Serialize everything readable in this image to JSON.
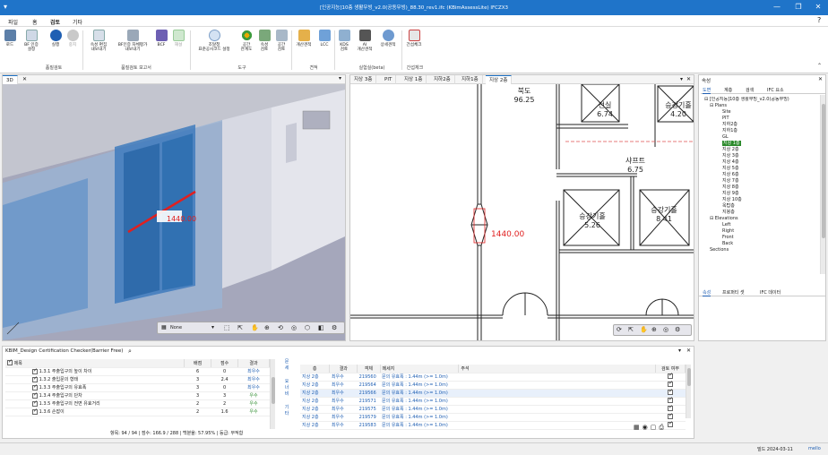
{
  "title": "[인공지능]10층 생활무빙_v2.0(공동무빙)_88.30_rev1.ifc (KBimAssessLite) IFCZX3",
  "menu": [
    "파일",
    "홈",
    "검토",
    "기타"
  ],
  "ribbon": {
    "buttons": [
      {
        "label": "로드",
        "icon": "load-icon"
      },
      {
        "label": "BF 인증\n설정",
        "icon": "document-settings-icon"
      },
      {
        "label": "실행",
        "icon": "play-icon"
      },
      {
        "label": "중지",
        "icon": "stop-icon"
      },
      {
        "label": "속성 편집\n내보내기",
        "icon": "properties-edit-icon"
      },
      {
        "label": "BF인증 자체평가\n내보내기",
        "icon": "export-icon"
      },
      {
        "label": "BCF",
        "icon": "bcf-icon"
      },
      {
        "label": "해설",
        "icon": "commentary-icon"
      },
      {
        "label": "조달청\n표준공사코드 설정",
        "icon": "standard-code-icon"
      },
      {
        "label": "공간\n관계도",
        "icon": "space-relation-icon"
      },
      {
        "label": "속성\n검토",
        "icon": "property-review-icon"
      },
      {
        "label": "공간\n검토",
        "icon": "space-review-icon"
      },
      {
        "label": "개산견적",
        "icon": "estimate-icon"
      },
      {
        "label": "LCC",
        "icon": "lcc-icon"
      },
      {
        "label": "KDS\n검토",
        "icon": "kds-icon"
      },
      {
        "label": "AI\n개산견적",
        "icon": "ai-estimate-icon"
      },
      {
        "label": "상세견적",
        "icon": "detail-estimate-icon"
      },
      {
        "label": "간섭체크",
        "icon": "clash-check-icon"
      }
    ],
    "groups": [
      "품질검토",
      "품질검토 보고서",
      "도구",
      "견적",
      "실험실(beta)",
      "간섭체크"
    ]
  },
  "view3d": {
    "tab": "3D",
    "dimension": "1440.00",
    "display_mode": "None"
  },
  "view2d": {
    "tabs": [
      "지상 3층",
      "PIT",
      "지상 1층",
      "지하2층",
      "지하1층",
      "지상 2층"
    ],
    "active_tab": "지상 2층",
    "labels": [
      {
        "name": "북도",
        "value": "96.25"
      },
      {
        "name": "전실",
        "value": "6.74"
      },
      {
        "name": "승강기홀",
        "value": "4.20"
      },
      {
        "name": "샤프트",
        "value": "6.75"
      },
      {
        "name": "승강기홀",
        "value": "5.26"
      },
      {
        "name": "승강기홀",
        "value": "8.41"
      }
    ],
    "dimension": "1440.00"
  },
  "properties": {
    "title": "속성",
    "tabs": [
      "도면",
      "계층",
      "검색",
      "IFC 요소"
    ],
    "tree": [
      "[인공지능]10층 생활무빙_v2.0(공동무빙)",
      "Plans",
      "Site",
      "PIT",
      "지하2층",
      "지하1층",
      "GL",
      "지상 1층",
      "지상 2층",
      "지상 3층",
      "지상 4층",
      "지상 5층",
      "지상 6층",
      "지상 7층",
      "지상 8층",
      "지상 9층",
      "지상 10층",
      "옥탑층",
      "지붕층",
      "Elevations",
      "Left",
      "Right",
      "Front",
      "Back",
      "Sections"
    ],
    "selected": "지상 1층",
    "bottom_tabs": [
      "속성",
      "프로퍼티 셋",
      "IFC 데이터"
    ]
  },
  "checker": {
    "title": "KBIM_Design Certification Checker(Barrier Free)",
    "columns": [
      "제목",
      "배점",
      "점수",
      "결과"
    ],
    "rows": [
      {
        "title": "1.3.1 주출입구의 높이 차이",
        "max": "6",
        "score": "0",
        "result": "최우수"
      },
      {
        "title": "1.3.2 출입문의 형태",
        "max": "3",
        "score": "2.4",
        "result": "최우수"
      },
      {
        "title": "1.3.3 주출입구의 유효폭",
        "max": "3",
        "score": "0",
        "result": "최우수"
      },
      {
        "title": "1.3.4 주출입구의 단차",
        "max": "3",
        "score": "3",
        "result": "우수"
      },
      {
        "title": "1.3.5 주출입구의 전면 유효거리",
        "max": "2",
        "score": "2",
        "result": "우수"
      },
      {
        "title": "1.3.6 손잡이",
        "max": "2",
        "score": "1.6",
        "result": "우수"
      }
    ],
    "summary": "항목: 94 / 94 | 점수: 166.9 / 288 | 백분율: 57.95% | 등급: 부적합",
    "side_labels": [
      "문",
      "세",
      "요",
      "너",
      "비",
      "기",
      "타"
    ]
  },
  "results": {
    "columns": [
      "층",
      "결과",
      "객체",
      "메세지",
      "주석",
      "검토 여부"
    ],
    "rows": [
      {
        "floor": "지상 2층",
        "result": "최우수",
        "object": "219560",
        "message": "문의 유효폭 : 1.44m (>= 1.0m)"
      },
      {
        "floor": "지상 2층",
        "result": "최우수",
        "object": "219564",
        "message": "문의 유효폭 : 1.44m (>= 1.0m)"
      },
      {
        "floor": "지상 2층",
        "result": "최우수",
        "object": "219566",
        "message": "문의 유효폭 : 1.44m (>= 1.0m)"
      },
      {
        "floor": "지상 2층",
        "result": "최우수",
        "object": "219571",
        "message": "문의 유효폭 : 1.44m (>= 1.0m)"
      },
      {
        "floor": "지상 2층",
        "result": "최우수",
        "object": "219575",
        "message": "문의 유효폭 : 1.44m (>= 1.0m)"
      },
      {
        "floor": "지상 2층",
        "result": "최우수",
        "object": "219579",
        "message": "문의 유효폭 : 1.44m (>= 1.0m)"
      },
      {
        "floor": "지상 2층",
        "result": "최우수",
        "object": "219583",
        "message": "문의 유효폭 : 1.44m (>= 1.0m)"
      }
    ]
  },
  "status": {
    "date": "빌드 2024-03-11",
    "link": "mello"
  },
  "colors": {
    "titlebar": "#1f74c9",
    "dimension": "#e02020",
    "glass": "#5b8fc9",
    "selected_floor": "#2b8a2b"
  }
}
